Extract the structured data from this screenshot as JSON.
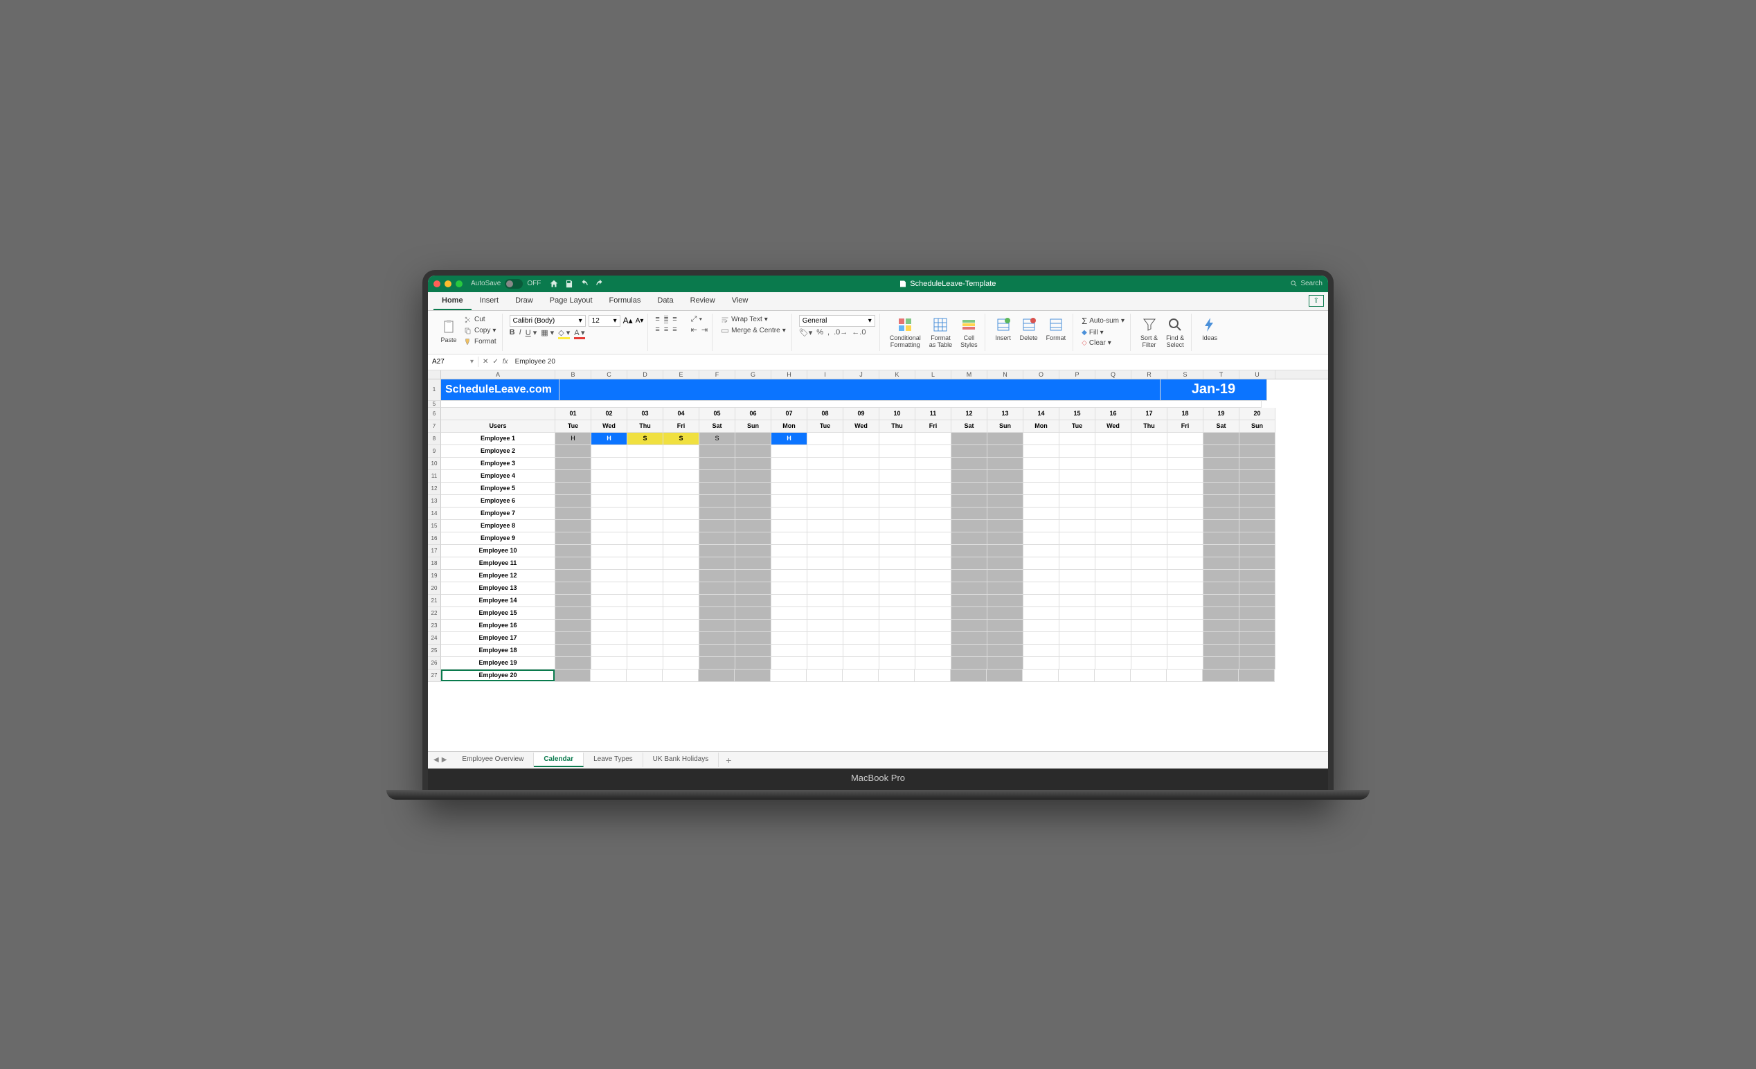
{
  "titlebar": {
    "autosave": "AutoSave",
    "off": "OFF",
    "docname": "ScheduleLeave-Template",
    "search": "Search"
  },
  "tabs": [
    "Home",
    "Insert",
    "Draw",
    "Page Layout",
    "Formulas",
    "Data",
    "Review",
    "View"
  ],
  "ribbon": {
    "paste": "Paste",
    "cut": "Cut",
    "copy": "Copy",
    "format": "Format",
    "font": "Calibri (Body)",
    "size": "12",
    "wrap": "Wrap Text",
    "merge": "Merge & Centre",
    "numfmt": "General",
    "cond": "Conditional\nFormatting",
    "fmtas": "Format\nas Table",
    "cellst": "Cell\nStyles",
    "insert": "Insert",
    "delete": "Delete",
    "formatc": "Format",
    "autosum": "Auto-sum",
    "fill": "Fill",
    "clear": "Clear",
    "sort": "Sort &\nFilter",
    "find": "Find &\nSelect",
    "ideas": "Ideas"
  },
  "formula": {
    "cell": "A27",
    "value": "Employee 20"
  },
  "cols": [
    "A",
    "B",
    "C",
    "D",
    "E",
    "F",
    "G",
    "H",
    "I",
    "J",
    "K",
    "L",
    "M",
    "N",
    "O",
    "P",
    "Q",
    "R",
    "S",
    "T",
    "U"
  ],
  "banner": {
    "logo": "ScheduleLeave.com",
    "month": "Jan-19"
  },
  "dates": [
    "01",
    "02",
    "03",
    "04",
    "05",
    "06",
    "07",
    "08",
    "09",
    "10",
    "11",
    "12",
    "13",
    "14",
    "15",
    "16",
    "17",
    "18",
    "19",
    "20"
  ],
  "days": [
    "Tue",
    "Wed",
    "Thu",
    "Fri",
    "Sat",
    "Sun",
    "Mon",
    "Tue",
    "Wed",
    "Thu",
    "Fri",
    "Sat",
    "Sun",
    "Mon",
    "Tue",
    "Wed",
    "Thu",
    "Fri",
    "Sat",
    "Sun"
  ],
  "usersLabel": "Users",
  "weekends": [
    0,
    4,
    5,
    11,
    12,
    18,
    19
  ],
  "employees": [
    "Employee 1",
    "Employee 2",
    "Employee 3",
    "Employee 4",
    "Employee 5",
    "Employee 6",
    "Employee 7",
    "Employee 8",
    "Employee 9",
    "Employee 10",
    "Employee 11",
    "Employee 12",
    "Employee 13",
    "Employee 14",
    "Employee 15",
    "Employee 16",
    "Employee 17",
    "Employee 18",
    "Employee 19",
    "Employee 20"
  ],
  "marks": {
    "0": {
      "0": "Hgrey",
      "1": "Hblue",
      "2": "Syel",
      "3": "Syel",
      "4": "Sgrey",
      "6": "Hblue"
    }
  },
  "sheettabs": [
    "Employee Overview",
    "Calendar",
    "Leave Types",
    "UK Bank Holidays"
  ],
  "activeSheet": 1,
  "laptop": "MacBook Pro"
}
